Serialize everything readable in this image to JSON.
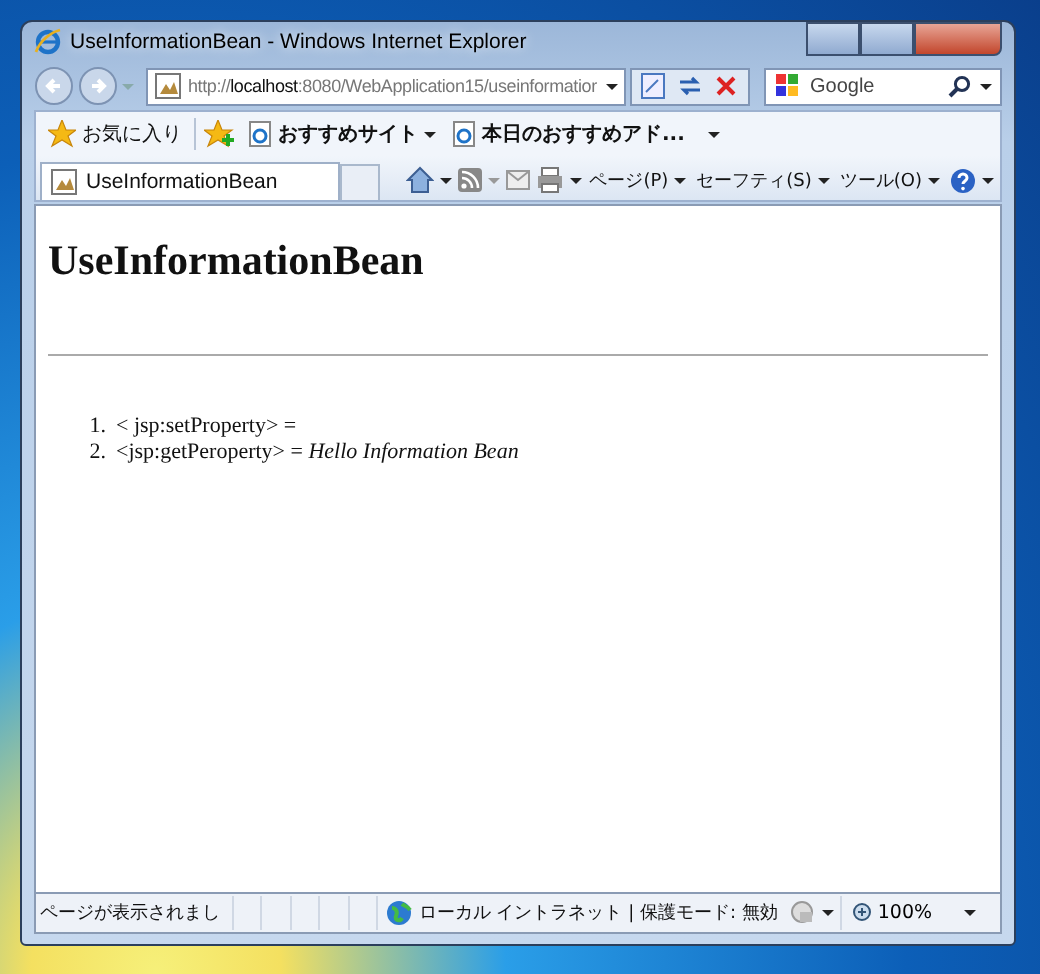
{
  "window": {
    "title": "UseInformationBean - Windows Internet Explorer"
  },
  "address_bar": {
    "url": "http://**localhost**:8080/WebApplication15/useinformatior"
  },
  "search_box": {
    "placeholder": "Google"
  },
  "favorites_bar": {
    "favorites_button": "お気に入り",
    "links": [
      "おすすめサイト",
      "本日のおすすめアド..."
    ]
  },
  "tabs": [
    {
      "label": "UseInformationBean",
      "selected": true
    }
  ],
  "command_bar": {
    "menus": [
      "ページ(P)",
      "セーフティ(S)",
      "ツール(O)"
    ]
  },
  "page": {
    "heading": "UseInformationBean",
    "items": [
      {
        "number": "1.",
        "text": "< jsp:setProperty> ="
      },
      {
        "number": "2.",
        "text": "<jsp:getPeroperty> = *Hello Information Bean*"
      }
    ]
  },
  "status_bar": {
    "status": "ページが表示されまし",
    "zone": "ローカル イントラネット | 保護モード: 無効",
    "zoom": "100%"
  }
}
